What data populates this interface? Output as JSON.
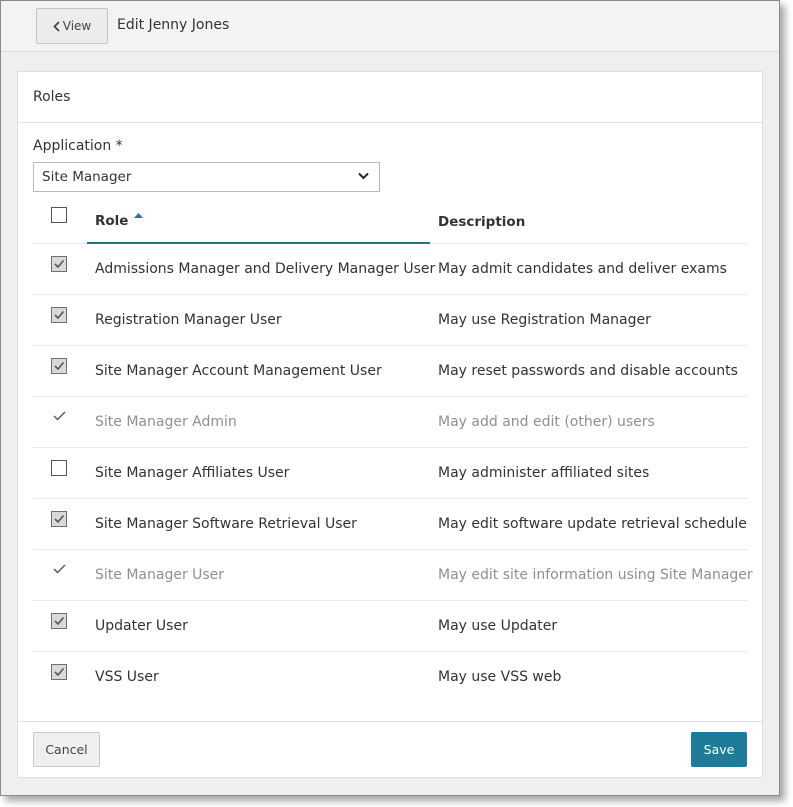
{
  "header": {
    "back_label": "View",
    "title": "Edit Jenny Jones"
  },
  "roles_panel": {
    "title": "Roles",
    "application_label": "Application *",
    "application_value": "Site Manager"
  },
  "table": {
    "columns": {
      "role": "Role",
      "description": "Description"
    },
    "sort": {
      "column": "role",
      "direction": "ascending"
    },
    "rows": [
      {
        "role": "Admissions Manager and Delivery Manager User",
        "description": "May admit candidates and deliver exams",
        "state": "checked"
      },
      {
        "role": "Registration Manager User",
        "description": "May use Registration Manager",
        "state": "checked"
      },
      {
        "role": "Site Manager Account Management User",
        "description": "May reset passwords and disable accounts",
        "state": "checked"
      },
      {
        "role": "Site Manager Admin",
        "description": "May add and edit (other) users",
        "state": "locked"
      },
      {
        "role": "Site Manager Affiliates User",
        "description": "May administer affiliated sites",
        "state": "unchecked"
      },
      {
        "role": "Site Manager Software Retrieval User",
        "description": "May edit software update retrieval schedule",
        "state": "checked"
      },
      {
        "role": "Site Manager User",
        "description": "May edit site information using Site Manager",
        "state": "locked"
      },
      {
        "role": "Updater User",
        "description": "May use Updater",
        "state": "checked"
      },
      {
        "role": "VSS User",
        "description": "May use VSS web",
        "state": "checked"
      }
    ]
  },
  "footer": {
    "cancel_label": "Cancel",
    "save_label": "Save"
  },
  "colors": {
    "primary": "#1f7c98",
    "sort_underline": "#2a6f8c",
    "disabled_text": "#8f8f8f"
  }
}
